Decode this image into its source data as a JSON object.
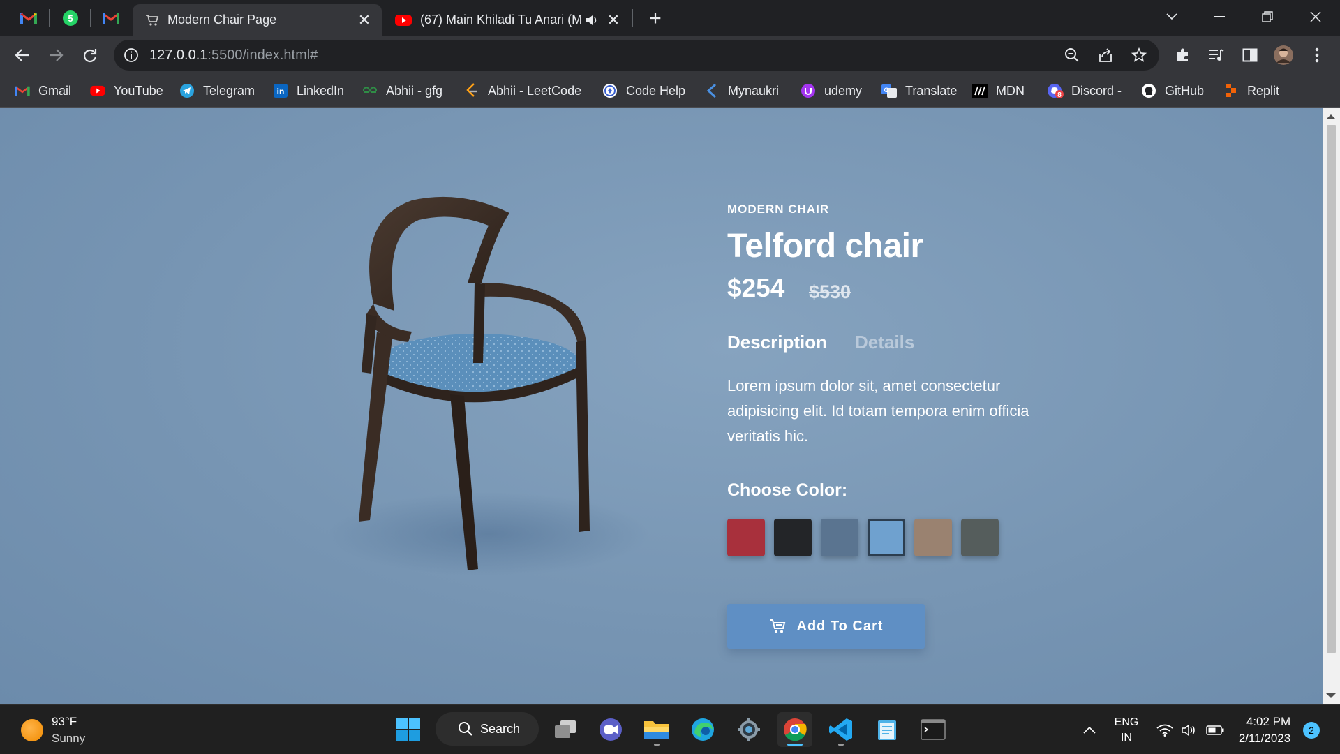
{
  "browser": {
    "pinned_tabs": [
      {
        "name": "Gmail"
      },
      {
        "name": "WhatsApp",
        "badge": "5"
      },
      {
        "name": "Gmail"
      }
    ],
    "tabs": [
      {
        "title": "Modern Chair Page",
        "active": true
      },
      {
        "title": "(67) Main Khiladi Tu Anari (M",
        "active": false,
        "muted_icon": "speaker-icon"
      }
    ],
    "address": {
      "host": "127.0.0.1",
      "path": ":5500/index.html#"
    },
    "bookmarks": [
      {
        "label": "Gmail",
        "icon": "gmail-icon"
      },
      {
        "label": "YouTube",
        "icon": "youtube-icon"
      },
      {
        "label": "Telegram",
        "icon": "telegram-icon"
      },
      {
        "label": "LinkedIn",
        "icon": "linkedin-icon"
      },
      {
        "label": "Abhii - gfg",
        "icon": "gfg-icon"
      },
      {
        "label": "Abhii - LeetCode",
        "icon": "leetcode-icon"
      },
      {
        "label": "Code Help",
        "icon": "codehelp-icon"
      },
      {
        "label": "Mynaukri",
        "icon": "mynaukri-icon"
      },
      {
        "label": "udemy",
        "icon": "udemy-icon"
      },
      {
        "label": "Translate",
        "icon": "translate-icon"
      },
      {
        "label": "MDN",
        "icon": "mdn-icon"
      },
      {
        "label": "Discord -",
        "icon": "discord-icon",
        "badge": "8"
      },
      {
        "label": "GitHub",
        "icon": "github-icon"
      },
      {
        "label": "Replit",
        "icon": "replit-icon"
      }
    ]
  },
  "product": {
    "eyebrow": "MODERN CHAIR",
    "name": "Telford chair",
    "price": "$254",
    "old_price": "$530",
    "tabs": [
      "Description",
      "Details"
    ],
    "description": "Lorem ipsum dolor sit, amet consectetur adipisicing elit. Id totam tempora enim officia veritatis hic.",
    "color_label": "Choose Color:",
    "colors": [
      {
        "name": "red",
        "hex": "#a8303c"
      },
      {
        "name": "black",
        "hex": "#232528"
      },
      {
        "name": "denim",
        "hex": "#5a7490"
      },
      {
        "name": "sky-blue",
        "hex": "#6fa1cf",
        "selected": true
      },
      {
        "name": "tan",
        "hex": "#9a8270"
      },
      {
        "name": "grey-green",
        "hex": "#555d5c"
      }
    ],
    "cart_label": "Add To Cart",
    "accent": "#5f8fc4"
  },
  "taskbar": {
    "weather": {
      "temp": "93°F",
      "condition": "Sunny"
    },
    "search_label": "Search",
    "lang": {
      "line1": "ENG",
      "line2": "IN"
    },
    "clock": {
      "time": "4:02 PM",
      "date": "2/11/2023"
    },
    "notifications": "2"
  }
}
